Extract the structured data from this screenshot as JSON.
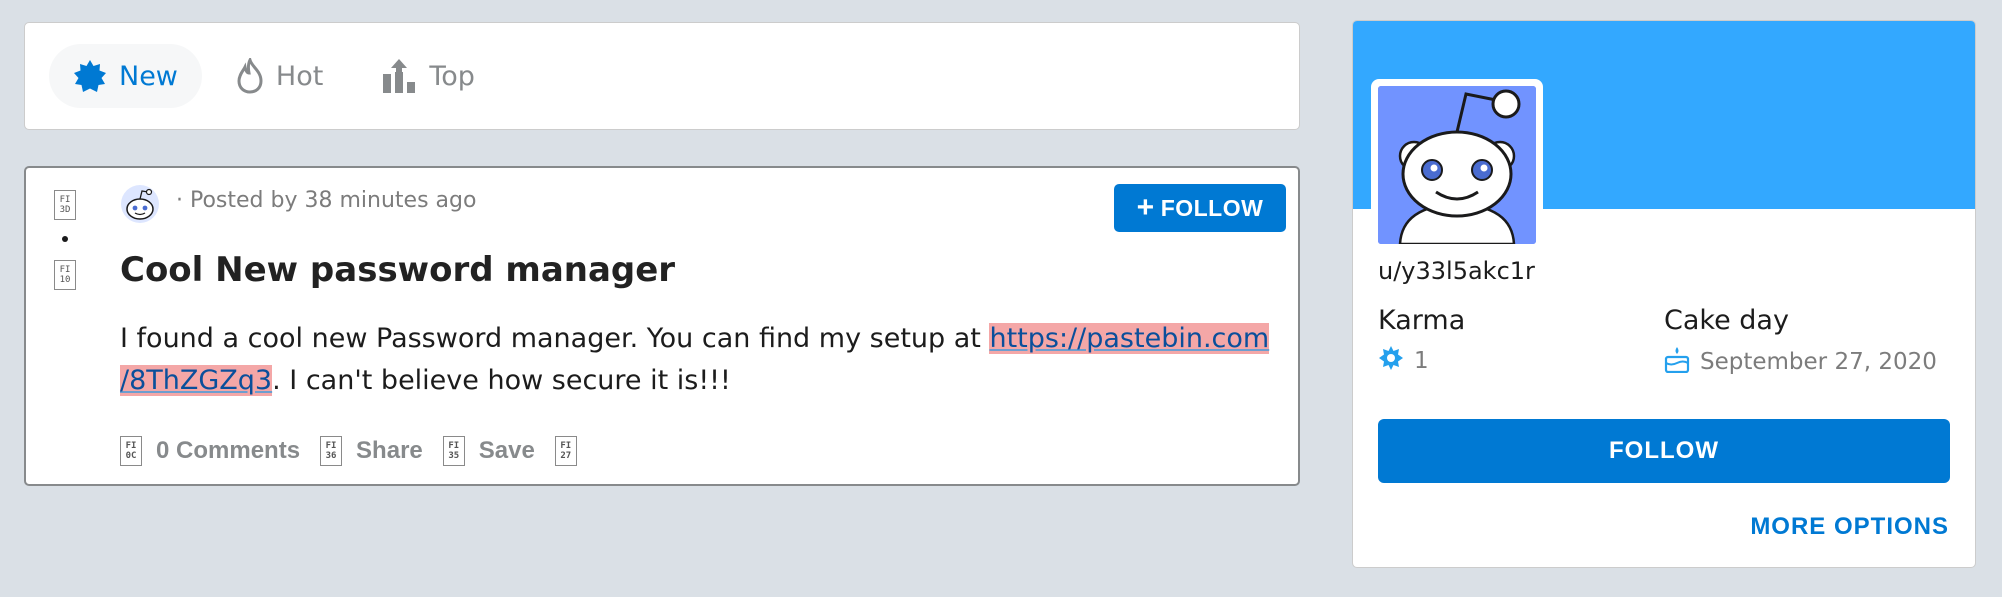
{
  "sort_bar": {
    "tabs": [
      {
        "label": "New",
        "icon": "burst-icon",
        "active": true
      },
      {
        "label": "Hot",
        "icon": "flame-icon",
        "active": false
      },
      {
        "label": "Top",
        "icon": "bar-chart-up-icon",
        "active": false
      }
    ]
  },
  "post": {
    "vote_glyphs": {
      "up": [
        "FI",
        "3D"
      ],
      "down": [
        "FI",
        "10"
      ]
    },
    "meta": "· Posted by 38 minutes ago",
    "follow_label": "FOLLOW",
    "title": "Cool New password manager",
    "body_before": "I found a cool new Password manager. You can find my setup at ",
    "link_line1": "https://pastebin.com",
    "link_line2": "/8ThZGZq3",
    "body_after": ". I can't believe how secure it is!!!",
    "actions": [
      {
        "label": "0 Comments",
        "glyph": [
          "FI",
          "0C"
        ]
      },
      {
        "label": "Share",
        "glyph": [
          "FI",
          "36"
        ]
      },
      {
        "label": "Save",
        "glyph": [
          "FI",
          "35"
        ]
      },
      {
        "label": "",
        "glyph": [
          "FI",
          "27"
        ]
      }
    ]
  },
  "sidebar": {
    "username": "u/y33l5akc1r",
    "karma_label": "Karma",
    "karma_value": "1",
    "cakeday_label": "Cake day",
    "cakeday_value": "September 27, 2020",
    "follow_label": "FOLLOW",
    "more_options_label": "MORE OPTIONS"
  },
  "colors": {
    "accent": "#0079d3",
    "banner": "#33a8ff",
    "avatar_bg": "#7193ff",
    "link_highlight": "#f4a7a7",
    "page_bg": "#dae0e6"
  }
}
